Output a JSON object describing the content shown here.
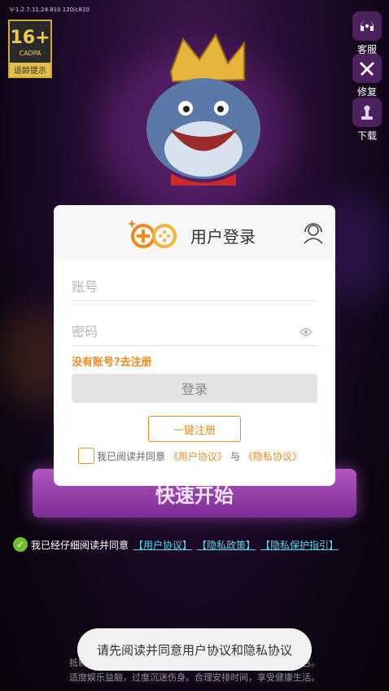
{
  "status": {
    "version": "V-1.2.7.11.24.810 120/c810"
  },
  "age_badge": {
    "age": "16+",
    "org": "CADPA",
    "tip": "适龄提示"
  },
  "side_buttons": [
    {
      "label": "客服",
      "icon": "headset-icon"
    },
    {
      "label": "修复",
      "icon": "wrench-icon"
    },
    {
      "label": "下载",
      "icon": "download-icon"
    }
  ],
  "modal": {
    "title": "用户登录",
    "account_placeholder": "账号",
    "password_placeholder": "密码",
    "register_link": "没有账号?去注册",
    "login_button": "登录",
    "quick_register_button": "一键注册",
    "agree_prefix": "我已阅读并同意",
    "user_agreement": "《用户协议》",
    "and": "与",
    "privacy_agreement": "《隐私协议》",
    "accent_color": "#f08a1f"
  },
  "background": {
    "start_button": "快速开始",
    "agree_text": "我已经仔细阅读并同意",
    "links": [
      "【用户协议】",
      "【隐私政策】",
      "【隐私保护指引】"
    ],
    "notice_line1": "抵制不良游戏，拒绝盗版游戏。注意自我保护，谨防受骗上当。",
    "notice_line2": "适度娱乐益脑，过度沉迷伤身。合理安排时间，享受健康生活。"
  },
  "toast": {
    "message": "请先阅读并同意用户协议和隐私协议"
  }
}
